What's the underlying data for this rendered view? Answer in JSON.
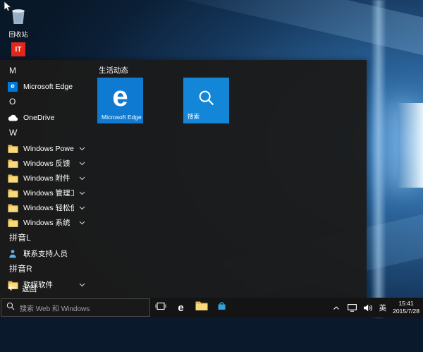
{
  "logo": {
    "edge_letter": "e"
  },
  "desktop": {
    "icons": [
      {
        "label": "回收站"
      },
      {
        "label": "IT"
      }
    ]
  },
  "start_menu": {
    "tiles": {
      "group_title": "生活动态",
      "edge_tile": {
        "label": "Microsoft Edge",
        "color": "#0f7ad1"
      },
      "search_tile": {
        "label": "搜索",
        "color": "#1486d8"
      }
    },
    "app_list": {
      "rows": [
        {
          "type": "header",
          "label": "M"
        },
        {
          "type": "item",
          "label": "Microsoft Edge",
          "icon": "edge",
          "chevron": false
        },
        {
          "type": "header",
          "label": "O"
        },
        {
          "type": "item",
          "label": "OneDrive",
          "icon": "onedrive",
          "chevron": false
        },
        {
          "type": "header",
          "label": "W"
        },
        {
          "type": "item",
          "label": "Windows PowerShell",
          "icon": "folder",
          "chevron": true
        },
        {
          "type": "item",
          "label": "Windows 反馈",
          "icon": "folder",
          "chevron": true
        },
        {
          "type": "item",
          "label": "Windows 附件",
          "icon": "folder",
          "chevron": true
        },
        {
          "type": "item",
          "label": "Windows 管理工具",
          "icon": "folder",
          "chevron": true
        },
        {
          "type": "item",
          "label": "Windows 轻松使用",
          "icon": "folder",
          "chevron": true
        },
        {
          "type": "item",
          "label": "Windows 系统",
          "icon": "folder",
          "chevron": true
        },
        {
          "type": "header",
          "label": "拼音L"
        },
        {
          "type": "item",
          "label": "联系支持人员",
          "icon": "person",
          "chevron": false
        },
        {
          "type": "header",
          "label": "拼音R"
        },
        {
          "type": "item",
          "label": "软媒软件",
          "icon": "folder",
          "chevron": true
        }
      ],
      "back_label": "返回"
    }
  },
  "taskbar": {
    "search_placeholder": "搜索 Web 和 Windows",
    "tray": {
      "input_indicator": "英",
      "time": "15:41",
      "date": "2015/7/28"
    }
  },
  "colors": {
    "accent": "#0078d7",
    "taskbar_bg": "#141414",
    "start_menu_bg": "#1b1b1b"
  }
}
